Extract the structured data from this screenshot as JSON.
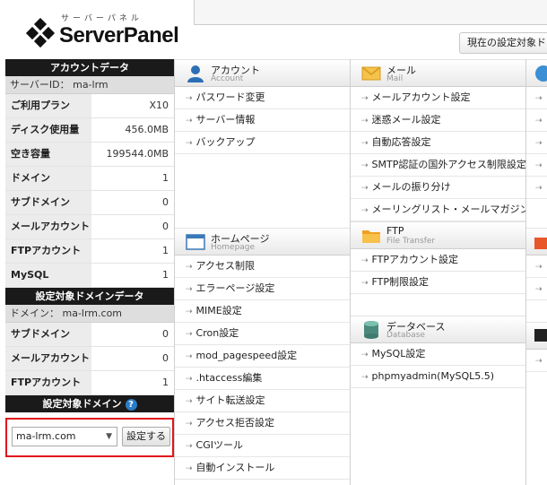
{
  "header": {
    "logo_kana": "サーバーパネル",
    "logo_text": "ServerPanel",
    "current_target_label": "現在の設定対象ド"
  },
  "sidebar": {
    "account_title": "アカウントデータ",
    "server_id": "サーバーID： ma-lrm",
    "account_rows": [
      {
        "label": "ご利用プラン",
        "value": "X10"
      },
      {
        "label": "ディスク使用量",
        "value": "456.0MB"
      },
      {
        "label": "空き容量",
        "value": "199544.0MB"
      },
      {
        "label": "ドメイン",
        "value": "1"
      },
      {
        "label": "サブドメイン",
        "value": "0"
      },
      {
        "label": "メールアカウント",
        "value": "0"
      },
      {
        "label": "FTPアカウント",
        "value": "1"
      },
      {
        "label": "MySQL",
        "value": "1"
      }
    ],
    "domain_title": "設定対象ドメインデータ",
    "domain_name": "ドメイン： ma-lrm.com",
    "domain_rows": [
      {
        "label": "サブドメイン",
        "value": "0"
      },
      {
        "label": "メールアカウント",
        "value": "0"
      },
      {
        "label": "FTPアカウント",
        "value": "1"
      }
    ],
    "target_title": "設定対象ドメイン",
    "help_glyph": "?",
    "select_value": "ma-lrm.com",
    "set_button": "設定する"
  },
  "sections": {
    "account": {
      "jp": "アカウント",
      "en": "Account",
      "items": [
        "パスワード変更",
        "サーバー情報",
        "バックアップ"
      ]
    },
    "homepage": {
      "jp": "ホームページ",
      "en": "Homepage",
      "items": [
        "アクセス制限",
        "エラーページ設定",
        "MIME設定",
        "Cron設定",
        "mod_pagespeed設定",
        ".htaccess編集",
        "サイト転送設定",
        "アクセス拒否設定",
        "CGIツール",
        "自動インストール"
      ]
    },
    "mail": {
      "jp": "メール",
      "en": "Mail",
      "items": [
        "メールアカウント設定",
        "迷惑メール設定",
        "自動応答設定",
        "SMTP認証の国外アクセス制限設定",
        "メールの振り分け",
        "メーリングリスト・メールマガジン"
      ]
    },
    "ftp": {
      "jp": "FTP",
      "en": "File Transfer",
      "items": [
        "FTPアカウント設定",
        "FTP制限設定"
      ]
    },
    "database": {
      "jp": "データベース",
      "en": "Database",
      "items": [
        "MySQL設定",
        "phpmyadmin(MySQL5.5)"
      ]
    }
  },
  "colors": {
    "accent_red": "#e0141e",
    "help_blue": "#2b7cc9",
    "dark_header": "#1a1a1a"
  }
}
